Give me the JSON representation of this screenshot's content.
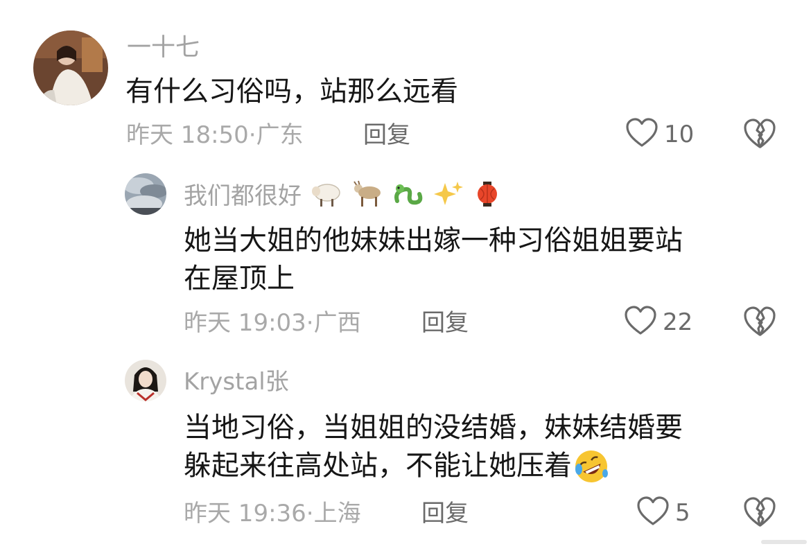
{
  "comments": [
    {
      "author": "一十七",
      "text_lines": [
        "有什么习俗吗，站那么远看"
      ],
      "time": "昨天 18:50·",
      "location": "广东",
      "reply_label": "回复",
      "likes": "10",
      "emojis": []
    },
    {
      "author": "我们都很好",
      "emojis": [
        "sheep-emoji",
        "goat-emoji",
        "dragon-emoji",
        "sparkles-emoji",
        "lantern-emoji"
      ],
      "text_lines": [
        "她当大姐的他妹妹出嫁一种习俗姐姐要站",
        "在屋顶上"
      ],
      "time": "昨天 19:03·",
      "location": "广西",
      "reply_label": "回复",
      "likes": "22"
    },
    {
      "author": "Krystal张",
      "emojis": [],
      "text_lines": [
        "当地习俗，当姐姐的没结婚，妹妹结婚要",
        "躲起来往高处站，不能让她压着"
      ],
      "trailing_emoji": "rolling-laughing-emoji",
      "time": "昨天 19:36·",
      "location": "上海",
      "reply_label": "回复",
      "likes": "5"
    }
  ],
  "colors": {
    "author": "#a3a3a3",
    "body": "#161616",
    "meta": "#a9a9a9",
    "action": "#6a6a6a"
  }
}
